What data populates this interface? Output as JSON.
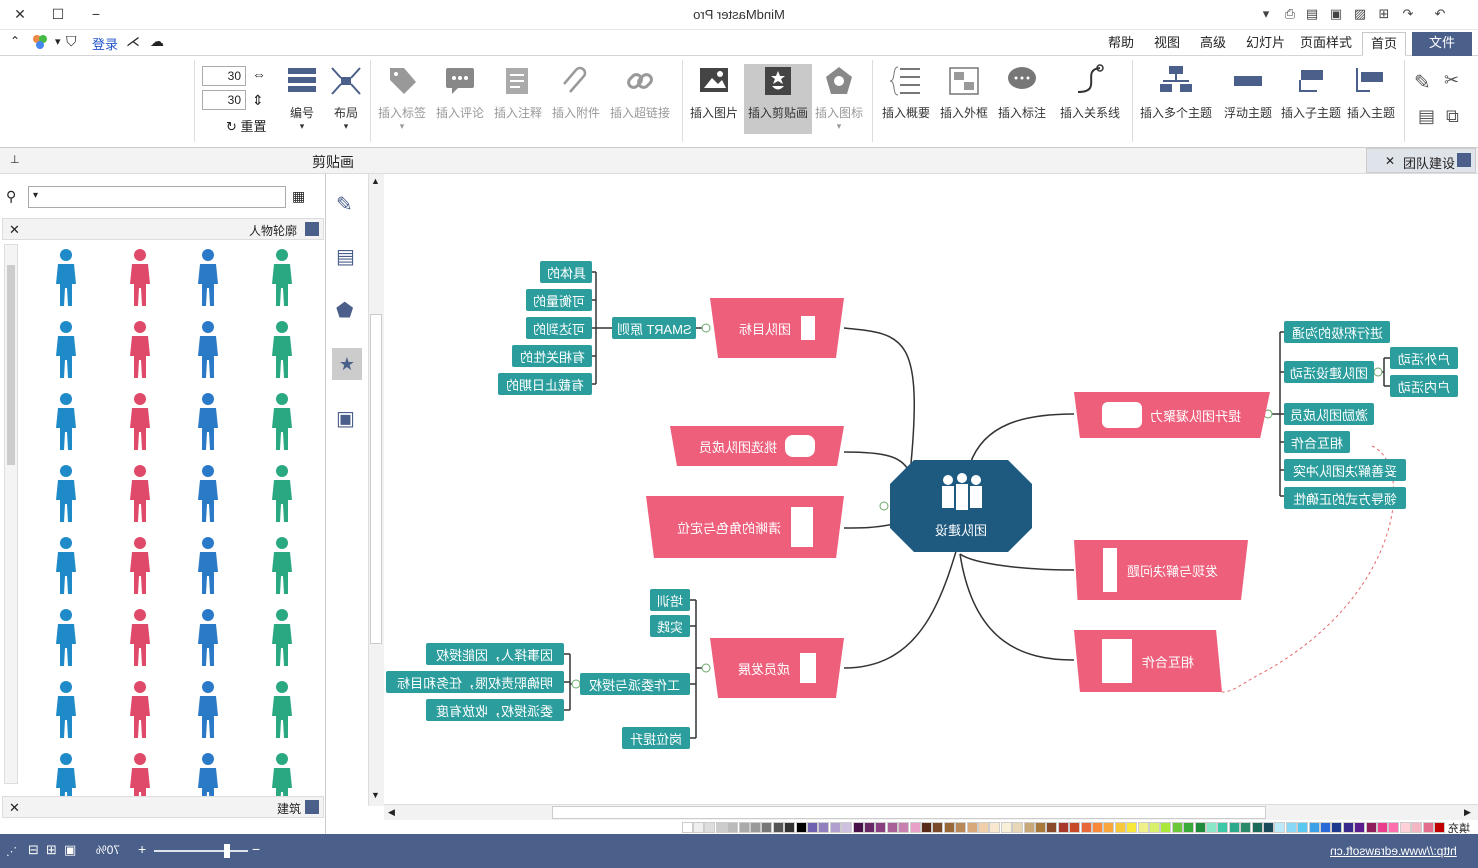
{
  "window": {
    "title": "MindMaster Pro",
    "min_label": "−",
    "max_label": "☐",
    "close_label": "✕"
  },
  "menu": {
    "tabs": [
      "文件",
      "首页",
      "页面样式",
      "幻灯片",
      "高级",
      "视图",
      "帮助"
    ],
    "active": "首页",
    "login_label": "登录"
  },
  "ribbon": {
    "buttons": [
      {
        "label": "插入主题",
        "icon": "insert-topic-icon"
      },
      {
        "label": "插入子主题",
        "icon": "insert-subtopic-icon"
      },
      {
        "label": "浮动主题",
        "icon": "floating-topic-icon"
      },
      {
        "label": "插入多个主题",
        "icon": "multiple-topics-icon"
      },
      {
        "label": "插入关系线",
        "icon": "relationship-icon"
      },
      {
        "label": "插入标注",
        "icon": "callout-icon"
      },
      {
        "label": "插入外框",
        "icon": "boundary-icon"
      },
      {
        "label": "插入概要",
        "icon": "summary-icon"
      },
      {
        "label": "插入图标",
        "icon": "icon-icon"
      },
      {
        "label": "插入剪贴画",
        "icon": "clipart-icon"
      },
      {
        "label": "插入图片",
        "icon": "picture-icon"
      },
      {
        "label": "插入超链接",
        "icon": "hyperlink-icon"
      },
      {
        "label": "插入附件",
        "icon": "attachment-icon"
      },
      {
        "label": "插入注释",
        "icon": "note-icon"
      },
      {
        "label": "插入评论",
        "icon": "comment-icon"
      },
      {
        "label": "插入标签",
        "icon": "tag-icon"
      }
    ],
    "layout_label": "布局",
    "number_label": "编号",
    "reset_label": "重置",
    "spacing_h": "30",
    "spacing_v": "30"
  },
  "panel": {
    "title": "剪贴画",
    "doc_tab": "团队建设",
    "section1": "人物轮廓",
    "section2": "建筑"
  },
  "mindmap": {
    "central": "团队建设",
    "topics": {
      "goal": "团队目标",
      "select": "挑选团队成员",
      "role": "清晰的角色与定位",
      "develop": "成员发展",
      "cohesion": "提升团队凝聚力",
      "problem": "发现与解决问题",
      "cooperate": "相互合作"
    },
    "smart": "SMART 原则",
    "smart_items": [
      "具体的",
      "可衡量的",
      "可达到的",
      "有相关性的",
      "有截止日期的"
    ],
    "develop_items": [
      "培训",
      "实践",
      "工作委派与授权",
      "岗位提升"
    ],
    "delegate_items": [
      "因事择人，因能授权",
      "明确职责权限，任务和目标",
      "委派授权，收放有度"
    ],
    "cohesion_items": [
      "进行积极的沟通",
      "团队建设活动",
      "激励团队成员",
      "相互合作",
      "妥善解决团队冲突",
      "领导方式的正确性"
    ],
    "activity_items": [
      "户外活动",
      "户内活动"
    ]
  },
  "status": {
    "url": "http://www.edrawsoft.cn",
    "zoom": "70%",
    "fill_label": "填充"
  },
  "palette": [
    "#c00000",
    "#e46c8c",
    "#f4b6c2",
    "#ffd0d8",
    "#ff6fb0",
    "#e83e8c",
    "#8e1e5c",
    "#5a1e8e",
    "#3a2a8e",
    "#1e3a8e",
    "#2a6ad8",
    "#3aa0e8",
    "#5ac8f0",
    "#8ad8f8",
    "#bdeaf8",
    "#1a4a5a",
    "#1e6a5a",
    "#2a8a6a",
    "#2aaa8a",
    "#3ac8a8",
    "#8ae8c8",
    "#1e8a3a",
    "#3aaa3a",
    "#6ac83a",
    "#aae83a",
    "#d8f06a",
    "#f0f08a",
    "#f8e83a",
    "#f8c83a",
    "#f8a83a",
    "#f8883a",
    "#e8683a",
    "#c8482a",
    "#a8382a",
    "#884a2a",
    "#a8783a",
    "#c8a878",
    "#e8d8b8",
    "#f8f0d8",
    "#f8e8d0",
    "#f0d0a8",
    "#d8a878",
    "#b88858",
    "#986838",
    "#784828",
    "#582818",
    "#e8a0c8",
    "#c880b0",
    "#a86098",
    "#884080",
    "#682868",
    "#481048",
    "#d0c0e0",
    "#b0a0d0",
    "#9080c0",
    "#7060b0",
    "#000000",
    "#333333",
    "#555555",
    "#777777",
    "#999999",
    "#aaaaaa",
    "#bbbbbb",
    "#cccccc",
    "#dddddd",
    "#eeeeee",
    "#ffffff"
  ]
}
